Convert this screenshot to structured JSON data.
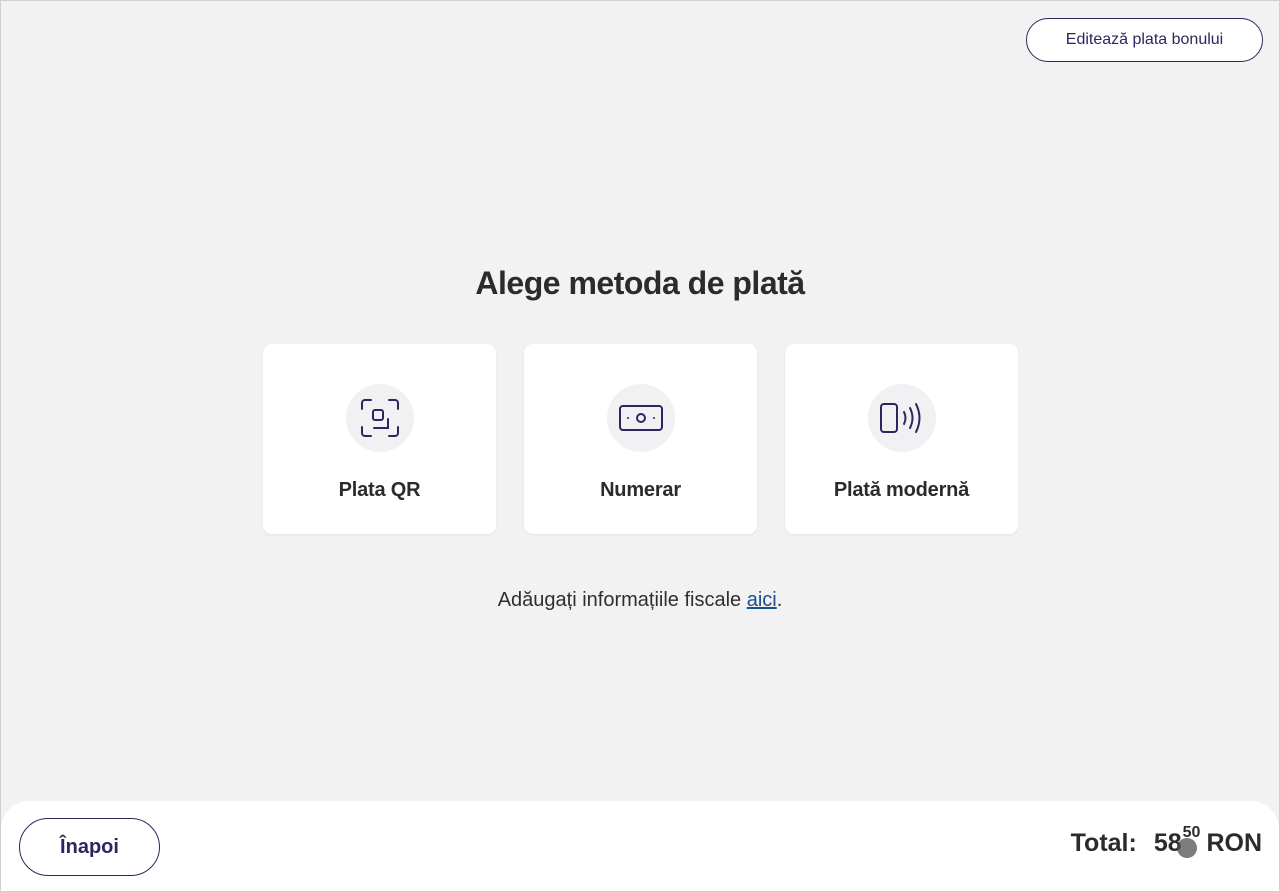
{
  "header": {
    "edit_button_label": "Editează plata bonului"
  },
  "main": {
    "title": "Alege metoda de plată",
    "methods": [
      {
        "label": "Plata QR",
        "icon": "qr-scan-icon"
      },
      {
        "label": "Numerar",
        "icon": "cash-icon"
      },
      {
        "label": "Plată modernă",
        "icon": "contactless-phone-icon"
      }
    ],
    "fiscal_text": "Adăugați informațiile fiscale ",
    "fiscal_link": "aici",
    "fiscal_end": "."
  },
  "footer": {
    "back_label": "Înapoi",
    "total_label": "Total:",
    "total_whole": "58",
    "total_cents": "50",
    "currency": "RON"
  },
  "colors": {
    "accent": "#2a2760",
    "link": "#1a4f8c",
    "background": "#f2f2f3"
  }
}
